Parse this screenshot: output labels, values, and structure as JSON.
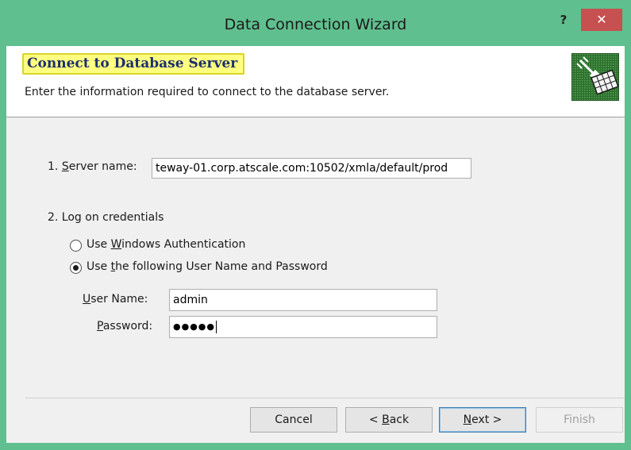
{
  "window": {
    "title": "Data Connection Wizard",
    "help_label": "?",
    "close_label": "✕",
    "chrome_color": "#5fbf8e",
    "close_color": "#c75050"
  },
  "header": {
    "title": "Connect to Database Server",
    "subtitle": "Enter the information required to connect to the database server.",
    "logo_icon": "database-plug-icon",
    "highlight_color": "#ffff80"
  },
  "form": {
    "server": {
      "prefix": "1. ",
      "mnemonic": "S",
      "rest": "erver name:",
      "value": "teway-01.corp.atscale.com:10502/xmla/default/prod"
    },
    "credentials_label": "2. Log on credentials",
    "option_windows": {
      "pre": "Use ",
      "mnemonic": "W",
      "post": "indows Authentication",
      "selected": false
    },
    "option_userpass": {
      "pre": "Use ",
      "mnemonic": "t",
      "post": "he following User Name and Password",
      "selected": true
    },
    "username": {
      "mnemonic": "U",
      "rest": "ser Name:",
      "value": "admin"
    },
    "password": {
      "mnemonic": "P",
      "rest": "assword:",
      "masked": "●●●●●"
    }
  },
  "buttons": {
    "cancel": "Cancel",
    "back": {
      "pre": "< ",
      "mnemonic": "B",
      "post": "ack"
    },
    "next": {
      "mnemonic": "N",
      "post": "ext >"
    },
    "finish": "Finish"
  }
}
